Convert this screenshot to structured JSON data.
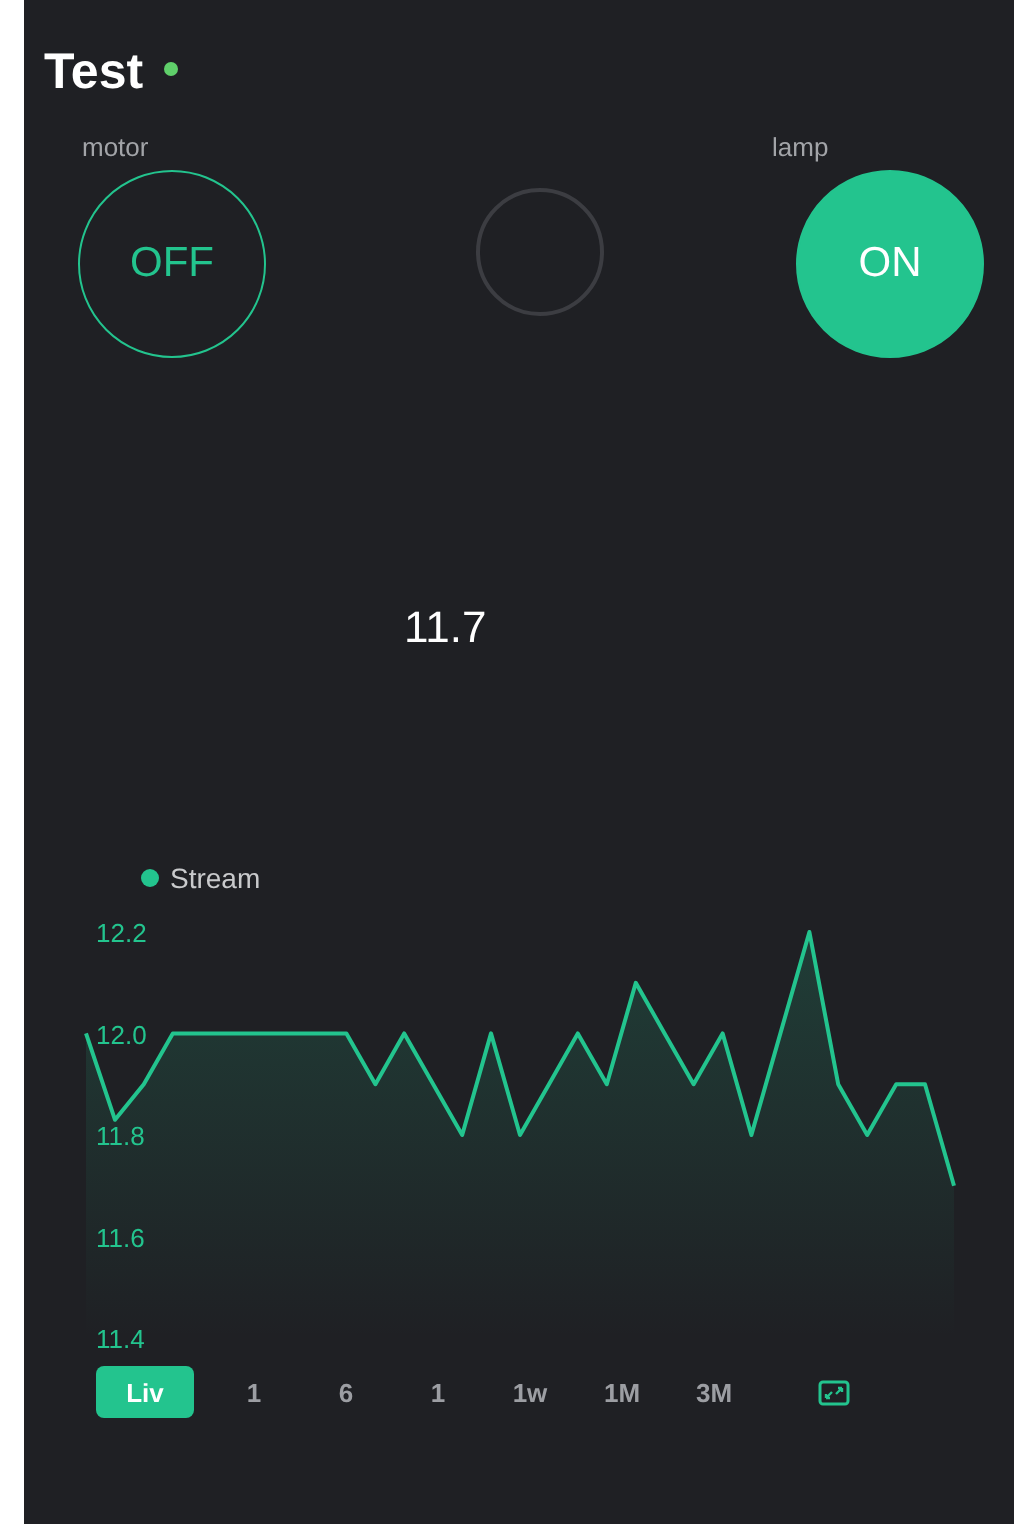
{
  "header": {
    "title": "Test",
    "online": true
  },
  "widgets": [
    {
      "kind": "button",
      "label": "motor",
      "text": "OFF",
      "on": false
    },
    {
      "kind": "led",
      "on": false
    },
    {
      "kind": "button",
      "label": "lamp",
      "text": "ON",
      "on": true
    }
  ],
  "value_display": "11.7",
  "graph": {
    "chart_data": {
      "type": "area",
      "yticks": [
        11.4,
        11.6,
        11.8,
        {
          "value": 12,
          "label": "12.0"
        },
        12.2
      ],
      "ylim": [
        11.4,
        12.2
      ],
      "series": [
        {
          "name": "Stream",
          "color": "#23c48e",
          "values": [
            12.0,
            11.83,
            11.9,
            12.0,
            12.0,
            12.0,
            12.0,
            12.0,
            12.0,
            12.0,
            11.9,
            12.0,
            11.9,
            11.8,
            12.0,
            11.8,
            11.9,
            12.0,
            11.9,
            12.1,
            12.0,
            11.9,
            12.0,
            11.8,
            12.0,
            12.2,
            11.9,
            11.8,
            11.9,
            11.9,
            11.7
          ]
        }
      ]
    },
    "ranges": [
      {
        "label": "Liv",
        "selected": true
      },
      {
        "label": "1",
        "selected": false
      },
      {
        "label": "6",
        "selected": false
      },
      {
        "label": "1",
        "selected": false
      },
      {
        "label": "1w",
        "selected": false
      },
      {
        "label": "1M",
        "selected": false
      },
      {
        "label": "3M",
        "selected": false
      }
    ]
  }
}
